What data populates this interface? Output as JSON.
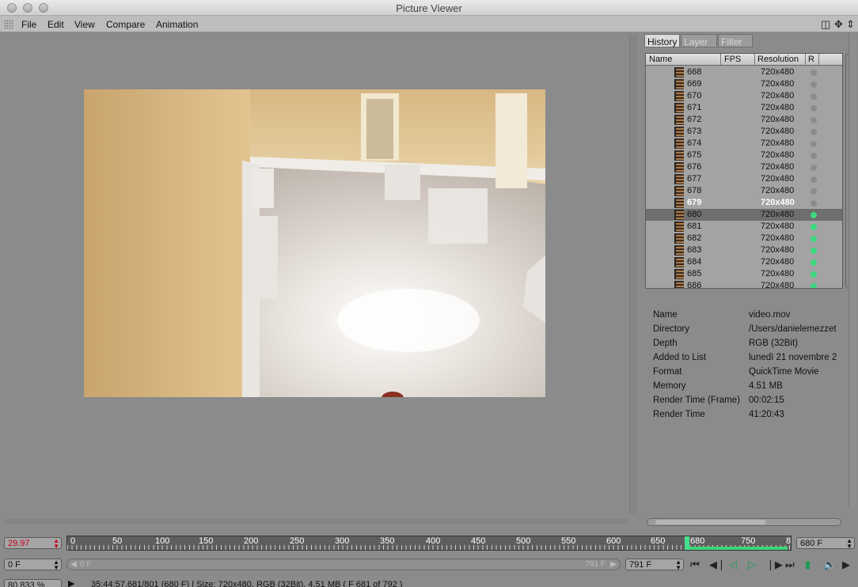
{
  "window": {
    "title": "Picture Viewer"
  },
  "menu": [
    "File",
    "Edit",
    "View",
    "Compare",
    "Animation"
  ],
  "menu_icons": [
    "layout-icon",
    "move-icon",
    "arrows-icon"
  ],
  "tabs": [
    "History",
    "Layer",
    "Filter"
  ],
  "list": {
    "headers": {
      "name": "Name",
      "fps": "FPS",
      "resolution": "Resolution",
      "r": "R"
    },
    "rows": [
      {
        "name": "668",
        "res": "720x480",
        "status": "gray"
      },
      {
        "name": "669",
        "res": "720x480",
        "status": "gray"
      },
      {
        "name": "670",
        "res": "720x480",
        "status": "gray"
      },
      {
        "name": "671",
        "res": "720x480",
        "status": "gray"
      },
      {
        "name": "672",
        "res": "720x480",
        "status": "gray"
      },
      {
        "name": "673",
        "res": "720x480",
        "status": "gray"
      },
      {
        "name": "674",
        "res": "720x480",
        "status": "gray"
      },
      {
        "name": "675",
        "res": "720x480",
        "status": "gray"
      },
      {
        "name": "676",
        "res": "720x480",
        "status": "gray"
      },
      {
        "name": "677",
        "res": "720x480",
        "status": "gray"
      },
      {
        "name": "678",
        "res": "720x480",
        "status": "gray"
      },
      {
        "name": "679",
        "res": "720x480",
        "status": "gray"
      },
      {
        "name": "680",
        "res": "720x480",
        "status": "green"
      },
      {
        "name": "681",
        "res": "720x480",
        "status": "green"
      },
      {
        "name": "682",
        "res": "720x480",
        "status": "green"
      },
      {
        "name": "683",
        "res": "720x480",
        "status": "green"
      },
      {
        "name": "684",
        "res": "720x480",
        "status": "green"
      },
      {
        "name": "685",
        "res": "720x480",
        "status": "green"
      },
      {
        "name": "686",
        "res": "720x480",
        "status": "green"
      }
    ],
    "selected": "680",
    "highlighted": "679"
  },
  "info": [
    {
      "key": "Name",
      "value": "video.mov"
    },
    {
      "key": "Directory",
      "value": "/Users/danielemezzet"
    },
    {
      "key": "Depth",
      "value": "RGB (32Bit)"
    },
    {
      "key": "Added to List",
      "value": "lunedì 21 novembre 2"
    },
    {
      "key": "Format",
      "value": "QuickTime Movie"
    },
    {
      "key": "Memory",
      "value": "4.51 MB"
    },
    {
      "key": "Render Time (Frame)",
      "value": "00:02:15"
    },
    {
      "key": "Render Time",
      "value": "41:20:43"
    }
  ],
  "timeline": {
    "fps": "29.97",
    "ticks": [
      "0",
      "50",
      "100",
      "150",
      "200",
      "250",
      "300",
      "350",
      "400",
      "450",
      "500",
      "550",
      "600",
      "650",
      "680",
      "750",
      "8"
    ],
    "current_frame_label": "680",
    "current_frame_field": "680 F",
    "range_start": "0 F",
    "range_start_inner": "0 F",
    "range_end_inner": "791 F",
    "range_end": "791 F",
    "green_color": "#3dd57a"
  },
  "transport_icons": [
    "first-frame-icon",
    "prev-key-icon",
    "play-back-icon",
    "play-forward-icon",
    "next-key-icon",
    "last-frame-icon",
    "loop-icon",
    "sound-icon",
    "more-icon"
  ],
  "status": {
    "zoom": "80.833 %",
    "text": "35:44:57.681/801 (680 F)  |  Size: 720x480, RGB (32Bit), 4.51 MB ( F 681 of 792 )"
  }
}
